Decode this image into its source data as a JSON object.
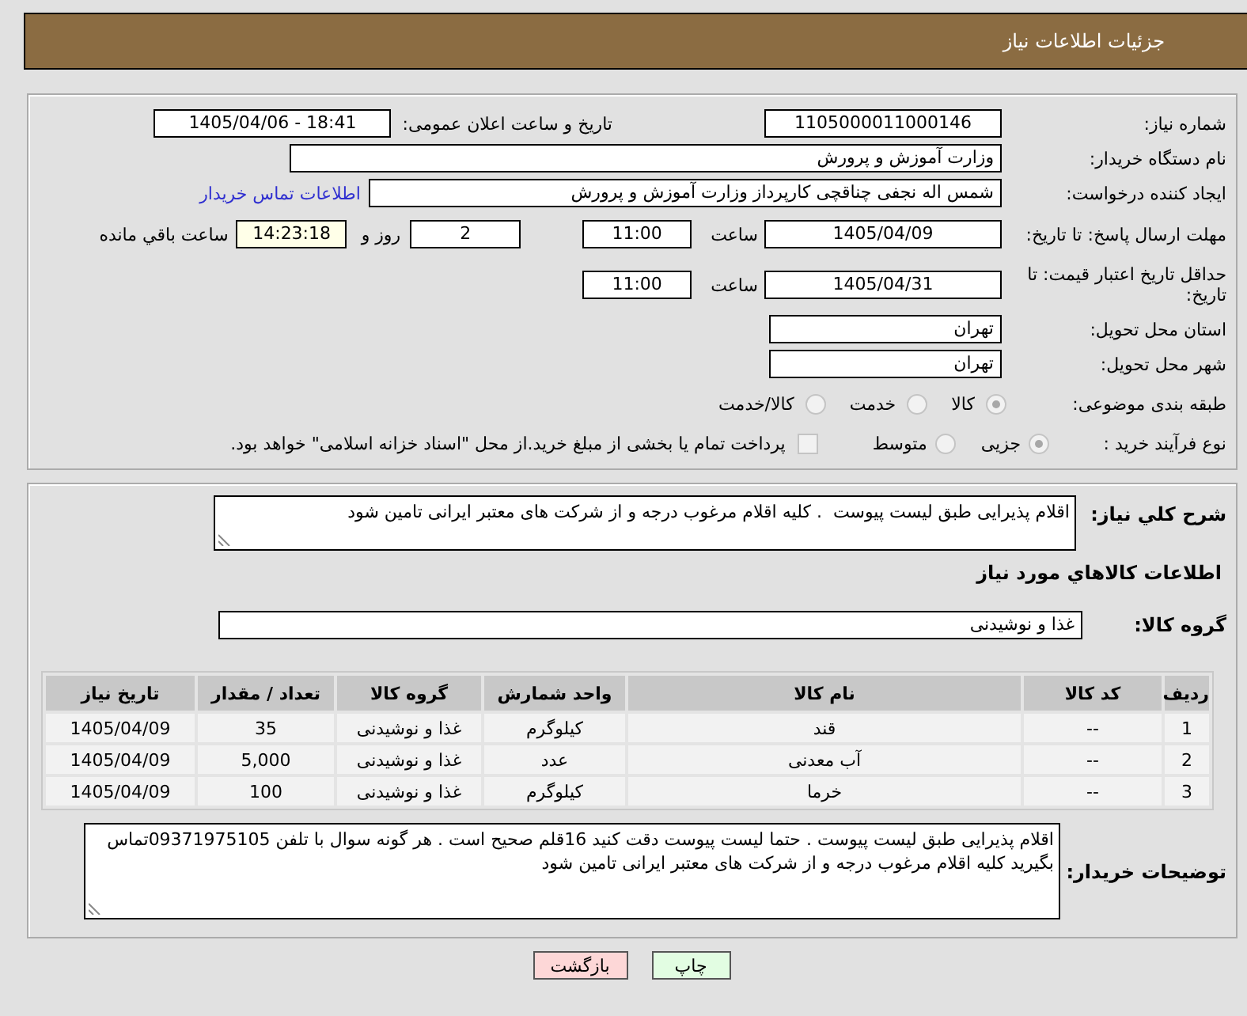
{
  "header": {
    "title": "جزئیات اطلاعات نیاز"
  },
  "details": {
    "need_number": {
      "label": "شماره نیاز:",
      "value": "1105000011000146"
    },
    "announce_datetime": {
      "label": "تاریخ و ساعت اعلان عمومی:",
      "value": "1405/04/06 - 18:41"
    },
    "buyer_org": {
      "label": "نام دستگاه خریدار:",
      "value": "وزارت آموزش و پرورش"
    },
    "requester": {
      "label": "ایجاد کننده درخواست:",
      "value": "شمس اله نجفی چناقچی کارپرداز وزارت آموزش و پرورش",
      "link": "اطلاعات تماس خریدار"
    },
    "reply_deadline": {
      "label": "مهلت ارسال پاسخ: تا تاریخ:",
      "date": "1405/04/09",
      "time_label": "ساعت",
      "time": "11:00",
      "days": "2",
      "days_label": "روز و",
      "remaining": "14:23:18",
      "remaining_label": "ساعت باقي مانده"
    },
    "price_validity": {
      "label": "حداقل تاریخ اعتبار قیمت: تا تاریخ:",
      "date": "1405/04/31",
      "time_label": "ساعت",
      "time": "11:00"
    },
    "province": {
      "label": "استان محل تحویل:",
      "value": "تهران"
    },
    "city": {
      "label": "شهر محل تحویل:",
      "value": "تهران"
    },
    "category": {
      "label": "طبقه بندی موضوعی:",
      "options": [
        {
          "label": "کالا",
          "selected": true,
          "disabled": true
        },
        {
          "label": "خدمت",
          "selected": false,
          "disabled": true
        },
        {
          "label": "کالا/خدمت",
          "selected": false,
          "disabled": true
        }
      ]
    },
    "purchase_type": {
      "label": "نوع فرآیند خرید :",
      "options": [
        {
          "label": "جزیی",
          "selected": true,
          "disabled": true
        },
        {
          "label": "متوسط",
          "selected": false,
          "disabled": true
        }
      ],
      "treasury": {
        "label": "پرداخت تمام یا بخشی از مبلغ خرید.از محل \"اسناد خزانه اسلامی\" خواهد بود.",
        "checked": false,
        "disabled": true
      }
    }
  },
  "summary": {
    "label": "شرح کلي نیاز:",
    "value": "اقلام پذیرایی طبق لیست پیوست  . کلیه اقلام مرغوب درجه و از شرکت های معتبر ایرانی تامین شود"
  },
  "goods": {
    "title": "اطلاعات کالاهاي مورد نیاز",
    "group_label": "گروه کالا:",
    "group_value": "غذا و نوشیدنی",
    "table": {
      "columns": [
        "ردیف",
        "کد کالا",
        "نام کالا",
        "واحد شمارش",
        "گروه کالا",
        "تعداد / مقدار",
        "تاریخ نیاز"
      ],
      "rows": [
        [
          "1",
          "--",
          "قند",
          "کیلوگرم",
          "غذا و نوشیدنی",
          "35",
          "1405/04/09"
        ],
        [
          "2",
          "--",
          "آب معدنی",
          "عدد",
          "غذا و نوشیدنی",
          "5,000",
          "1405/04/09"
        ],
        [
          "3",
          "--",
          "خرما",
          "کیلوگرم",
          "غذا و نوشیدنی",
          "100",
          "1405/04/09"
        ]
      ]
    }
  },
  "buyer_notes": {
    "label": "توضیحات خریدار:",
    "value": "اقلام پذیرایی طبق لیست پیوست . حتما لیست پیوست دقت کنید 16قلم صحیح است . هر گونه سوال با تلفن 09371975105تماس بگیرید کلیه اقلام مرغوب درجه و از شرکت های معتبر ایرانی تامین شود"
  },
  "buttons": [
    {
      "label": "چاپ",
      "kind": "print"
    },
    {
      "label": "بازگشت",
      "kind": "back"
    }
  ]
}
